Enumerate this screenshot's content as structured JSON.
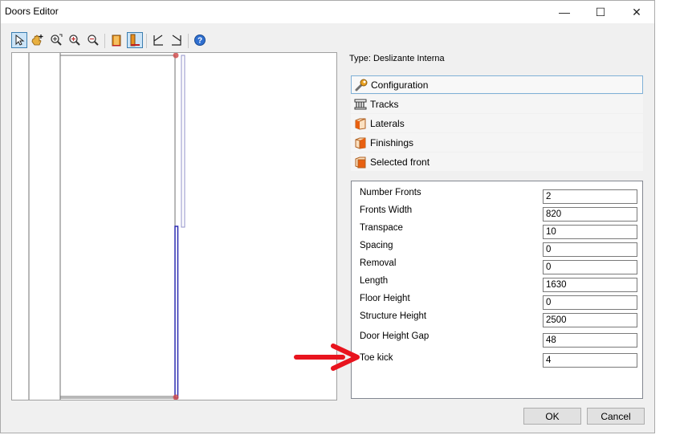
{
  "window": {
    "title": "Doors Editor"
  },
  "titlebar_buttons": {
    "minimize": "—",
    "maximize": "☐",
    "close": "✕"
  },
  "type_label": "Type: Deslizante Interna",
  "sections": [
    {
      "label": "Configuration",
      "icon": "wrench-icon"
    },
    {
      "label": "Tracks",
      "icon": "tracks-icon"
    },
    {
      "label": "Laterals",
      "icon": "laterals-box-icon"
    },
    {
      "label": "Finishings",
      "icon": "finishings-box-icon"
    },
    {
      "label": "Selected front",
      "icon": "selected-front-box-icon"
    }
  ],
  "properties": [
    {
      "label": "Number Fronts",
      "value": "2"
    },
    {
      "label": "Fronts Width",
      "value": "820"
    },
    {
      "label": "Transpace",
      "value": "10"
    },
    {
      "label": "Spacing",
      "value": "0"
    },
    {
      "label": "Removal",
      "value": "0"
    },
    {
      "label": "Length",
      "value": "1630"
    },
    {
      "label": "Floor Height",
      "value": "0"
    },
    {
      "label": "Structure Height",
      "value": "2500"
    },
    {
      "label": "Door Height Gap",
      "value": "48"
    },
    {
      "label": "Toe kick",
      "value": "4"
    }
  ],
  "buttons": {
    "ok": "OK",
    "cancel": "Cancel"
  },
  "colors": {
    "accent": "#3c7fb1",
    "door_outline": "#2b2bb0",
    "arrow": "#e8141e",
    "marker": "#d05050"
  }
}
